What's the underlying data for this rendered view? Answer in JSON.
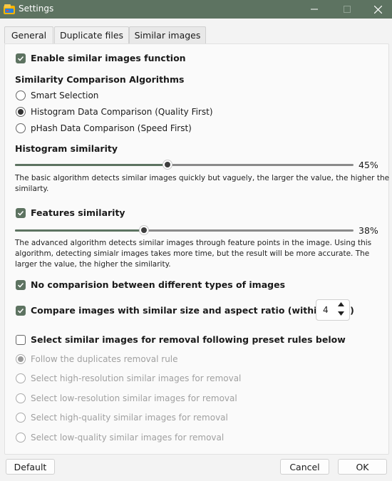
{
  "window": {
    "title": "Settings",
    "minimize_icon": "minimize-icon",
    "maximize_icon": "maximize-icon",
    "close_icon": "close-icon"
  },
  "tabs": [
    {
      "label": "General"
    },
    {
      "label": "Duplicate files"
    },
    {
      "label": "Similar images"
    }
  ],
  "active_tab": "Similar images",
  "enable": {
    "label": "Enable similar images function",
    "checked": true
  },
  "algorithms": {
    "heading": "Similarity Comparison Algorithms",
    "options": [
      {
        "label": "Smart Selection",
        "selected": false
      },
      {
        "label": "Histogram Data Comparison (Quality First)",
        "selected": true
      },
      {
        "label": "pHash Data Comparison (Speed First)",
        "selected": false
      }
    ]
  },
  "histogram": {
    "heading": "Histogram similarity",
    "value_percent": 45,
    "value_label": "45%",
    "description_line1": "The basic algorithm detects similar images quickly but vaguely, the larger the value, the higher the",
    "description_line2": "similarty."
  },
  "features": {
    "label": "Features similarity",
    "checked": true,
    "value_percent": 38,
    "value_label": "38%",
    "description_line1": "The advanced algorithm detects similar images through feature points in the image. Using this",
    "description_line2": "algorithm, detecting simialr images takes more time, but the result will be more accurate. The",
    "description_line3": "larger the value, the higher the similarity."
  },
  "no_compare_types": {
    "label": "No comparision between different types of images",
    "checked": true
  },
  "compare_size": {
    "label": "Compare images with similar size and aspect ratio (within ratio)",
    "checked": true,
    "ratio_value": "4"
  },
  "removal": {
    "label": "Select similar images for removal following preset rules below",
    "checked": false,
    "options": [
      {
        "label": "Follow the duplicates removal rule",
        "selected": true
      },
      {
        "label": "Select high-resolution similar images for removal",
        "selected": false
      },
      {
        "label": "Select low-resolution similar images for removal",
        "selected": false
      },
      {
        "label": "Select high-quality similar images for removal",
        "selected": false
      },
      {
        "label": "Select low-quality similar images for removal",
        "selected": false
      }
    ]
  },
  "buttons": {
    "default": "Default",
    "cancel": "Cancel",
    "ok": "OK"
  },
  "colors": {
    "accent": "#5d7361",
    "titlebar": "#5d7361",
    "disabled_text": "#a0a0a0"
  }
}
